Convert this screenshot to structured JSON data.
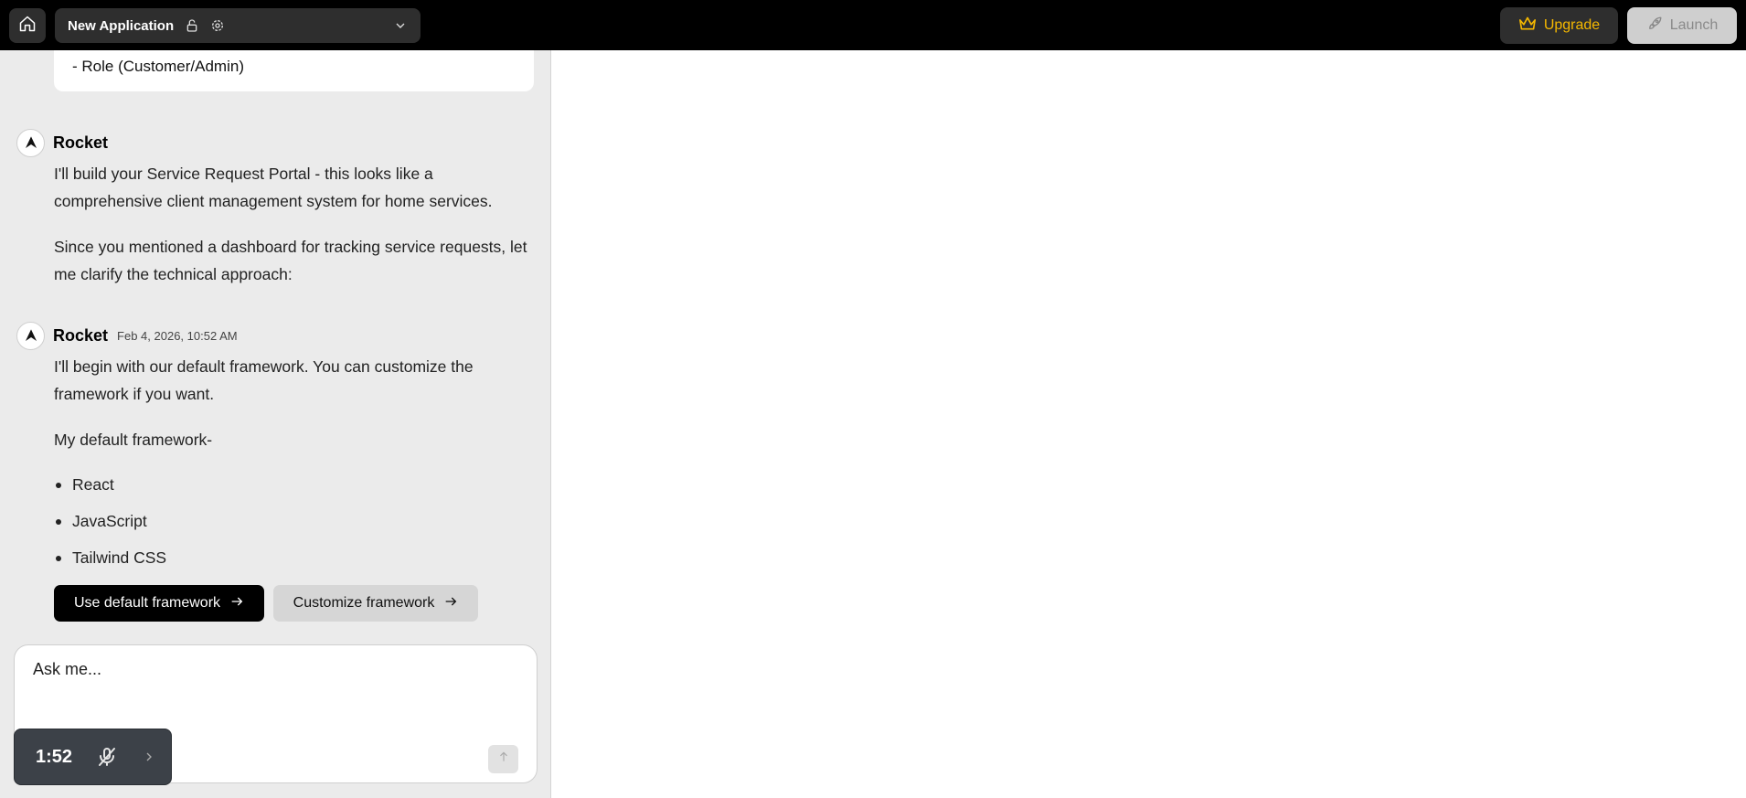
{
  "topbar": {
    "app_name": "New Application",
    "upgrade_label": "Upgrade",
    "launch_label": "Launch",
    "icons": [
      "home-icon",
      "lock-icon",
      "gear-icon",
      "chevron-down-icon",
      "crown-icon",
      "rocket-icon"
    ],
    "colors": {
      "bar": "#000000",
      "upgrade_text": "#f5b800",
      "launch_bg": "#cfcfcf"
    }
  },
  "chat": {
    "user_message_tail": "- Role (Customer/Admin)",
    "messages": [
      {
        "sender": "Rocket",
        "timestamp": "",
        "paragraphs": [
          "I'll build your Service Request Portal - this looks like a comprehensive client management system for home services.",
          "Since you mentioned a dashboard for tracking service requests, let me clarify the technical approach:"
        ]
      },
      {
        "sender": "Rocket",
        "timestamp": "Feb 4, 2026, 10:52 AM",
        "paragraphs": [
          "I'll begin with our default framework. You can customize the framework if you want.",
          "My default framework-"
        ],
        "bullets": [
          "React",
          "JavaScript",
          "Tailwind CSS"
        ]
      }
    ],
    "actions": {
      "use_default": "Use default framework",
      "customize": "Customize framework"
    },
    "composer": {
      "placeholder": "Ask me..."
    },
    "voice": {
      "elapsed": "1:52",
      "icons": [
        "mic-off-icon",
        "chevron-right-icon"
      ]
    }
  }
}
